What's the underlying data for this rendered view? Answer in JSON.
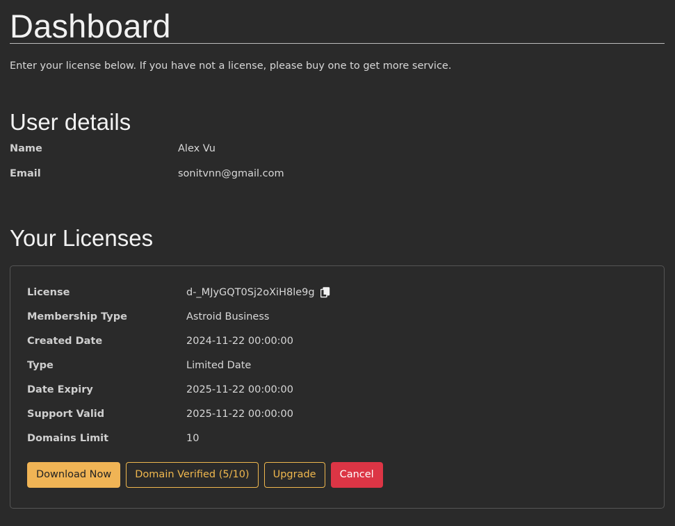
{
  "header": {
    "title": "Dashboard",
    "intro": "Enter your license below. If you have not a license, please buy one to get more service."
  },
  "user": {
    "title": "User details",
    "rows": [
      {
        "label": "Name",
        "value": "Alex Vu"
      },
      {
        "label": "Email",
        "value": "sonitvnn@gmail.com"
      }
    ]
  },
  "licenses": {
    "title": "Your Licenses",
    "rows": [
      {
        "label": "License",
        "value": "d-_MJyGQT0Sj2oXiH8le9g"
      },
      {
        "label": "Membership Type",
        "value": "Astroid Business"
      },
      {
        "label": "Created Date",
        "value": "2024-11-22 00:00:00"
      },
      {
        "label": "Type",
        "value": "Limited Date"
      },
      {
        "label": "Date Expiry",
        "value": "2025-11-22 00:00:00"
      },
      {
        "label": "Support Valid",
        "value": "2025-11-22 00:00:00"
      },
      {
        "label": "Domains Limit",
        "value": "10"
      }
    ],
    "copy_icon": "copy-icon",
    "actions": {
      "download": "Download Now",
      "domain_verified": "Domain Verified (5/10)",
      "upgrade": "Upgrade",
      "cancel": "Cancel"
    }
  },
  "colors": {
    "background": "#2a2a2a",
    "accent": "#f0b455",
    "danger": "#dc3545"
  }
}
